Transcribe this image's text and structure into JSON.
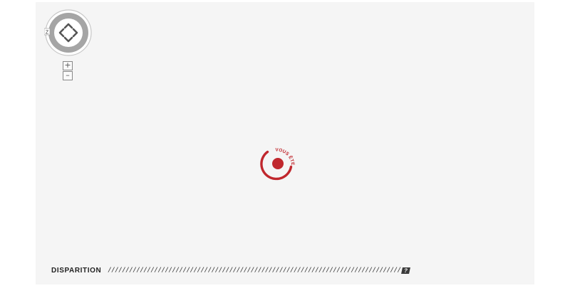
{
  "map": {
    "navigator": {
      "icons": [
        "arrow-up-icon",
        "arrow-down-icon",
        "arrow-left-icon",
        "arrow-right-icon"
      ],
      "badge": "Z"
    },
    "zoom": {
      "in_label": "+",
      "out_label": "–"
    },
    "marker": {
      "label": "VOUS ÊTES ICI",
      "color": "#c0272d"
    }
  },
  "footer": {
    "label": "DISPARITION",
    "slashes": "//////////////////////////////////////////////////////////////////////////////////",
    "help_label": "?"
  }
}
